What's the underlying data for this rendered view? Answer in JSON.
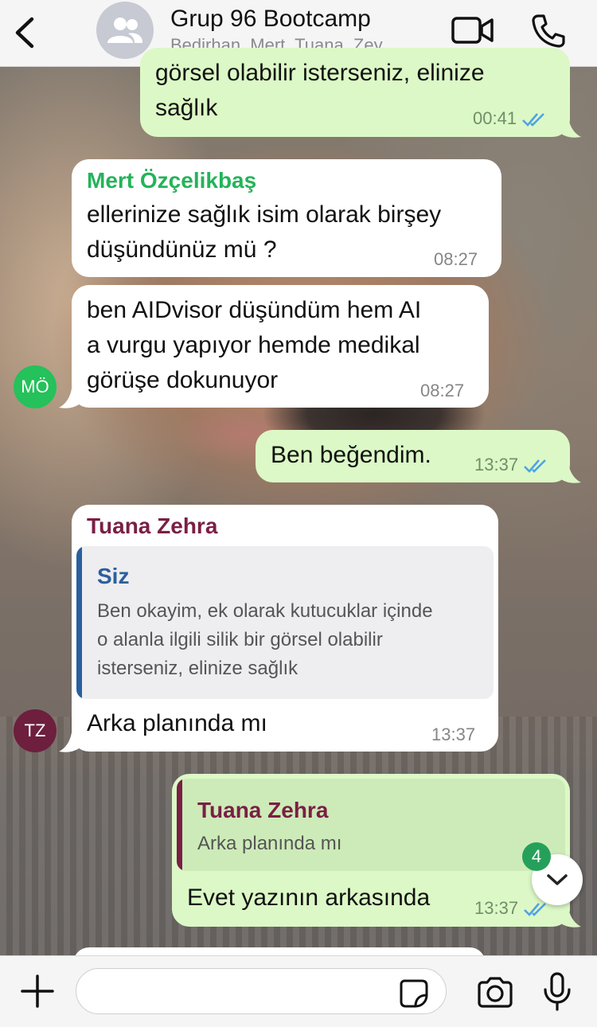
{
  "header": {
    "title": "Grup 96 Bootcamp",
    "subtitle": "Bedirhan, Mert, Tuana, Zey..."
  },
  "messages": [
    {
      "id": "m1",
      "direction": "outgoing",
      "lines": [
        "görsel olabilir isterseniz, elinize",
        "sağlık"
      ],
      "time": "00:41",
      "status": "read"
    },
    {
      "id": "m2",
      "direction": "incoming",
      "sender": "Mert Özçelikbaş",
      "sender_color": "#25b35a",
      "lines": [
        "ellerinize sağlık isim olarak birşey",
        "düşündünüz mü ?"
      ],
      "time": "08:27"
    },
    {
      "id": "m3",
      "direction": "incoming",
      "lines": [
        "ben AIDvisor düşündüm hem AI",
        "a vurgu yapıyor hemde medikal",
        "görüşe dokunuyor"
      ],
      "time": "08:27",
      "avatar_initials": "MÖ",
      "avatar_color": "#25c15a"
    },
    {
      "id": "m4",
      "direction": "outgoing",
      "lines": [
        "Ben beğendim."
      ],
      "time": "13:37",
      "status": "read"
    },
    {
      "id": "m5",
      "direction": "incoming",
      "sender": "Tuana Zehra",
      "sender_color": "#7a1f45",
      "quote": {
        "author": "Siz",
        "author_color": "#2a5f9e",
        "lines": [
          "Ben okayim, ek olarak kutucuklar içinde",
          "o alanla ilgili  silik bir görsel olabilir",
          "isterseniz, elinize sağlık"
        ]
      },
      "lines": [
        "Arka planında mı"
      ],
      "time": "13:37",
      "avatar_initials": "TZ",
      "avatar_color": "#6d1f3d"
    },
    {
      "id": "m6",
      "direction": "outgoing",
      "quote": {
        "author": "Tuana Zehra",
        "author_color": "#7a1f45",
        "lines": [
          "Arka planında mı"
        ]
      },
      "lines": [
        "Evet yazının arkasında"
      ],
      "time": "13:37",
      "status": "read"
    }
  ],
  "scroll_to_bottom": {
    "unread_count": "4"
  },
  "colors": {
    "incoming_bubble": "#ffffff",
    "outgoing_bubble": "#dcf8c6",
    "read_ticks": "#4fa3e6"
  },
  "icons": [
    "back-chevron-icon",
    "group-avatar-icon",
    "video-call-icon",
    "phone-icon",
    "read-ticks-icon",
    "chevron-down-icon",
    "plus-icon",
    "sticker-icon",
    "camera-icon",
    "microphone-icon"
  ]
}
